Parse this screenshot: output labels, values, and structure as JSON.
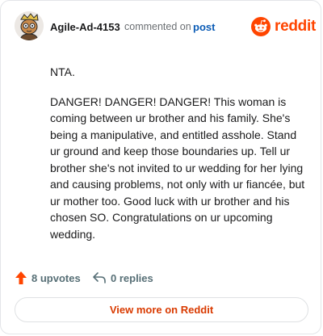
{
  "header": {
    "username": "Agile-Ad-4153",
    "commented_text": "commented on",
    "post_link": "post",
    "brand_word": "reddit"
  },
  "comment": {
    "paragraphs": [
      "NTA.",
      "DANGER! DANGER! DANGER! This woman is coming between ur brother and his family. She's being a manipulative, and entitled asshole. Stand ur ground and keep those boundaries up. Tell ur brother she's not invited to ur wedding for her lying and causing problems, not only with ur fiancée, but ur mother too. Good luck with ur brother and his chosen SO. Congratulations on ur upcoming wedding."
    ]
  },
  "actions": {
    "upvotes": "8 upvotes",
    "replies": "0 replies"
  },
  "footer": {
    "view_more": "View more on Reddit"
  },
  "icons": {
    "avatar": "user-avatar",
    "brand": "reddit-icon",
    "upvote": "upvote-arrow-icon",
    "reply": "reply-arrow-icon"
  },
  "colors": {
    "brand_orange": "#ff4500",
    "upvote_red": "#d93a00",
    "link_blue": "#0a5bb5",
    "muted": "#576f76",
    "text": "#1a1a1b",
    "border": "#e3e5e8"
  }
}
